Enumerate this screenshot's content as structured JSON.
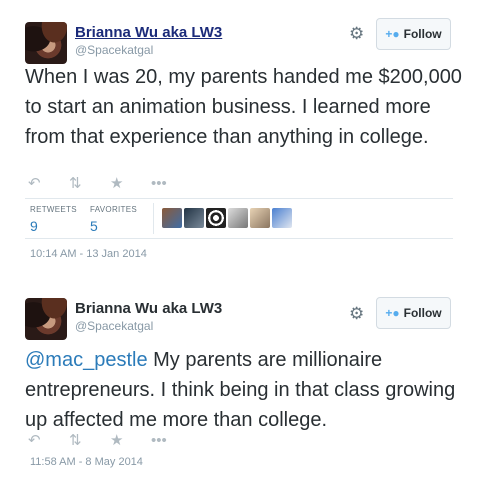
{
  "tweets": [
    {
      "name": "Brianna Wu aka LW3",
      "handle": "@Spacekatgal",
      "follow_label": "Follow",
      "text": "When I was 20, my parents handed me $200,000 to start an animation business. I learned more from that experience than anything in college.",
      "retweets_label": "RETWEETS",
      "retweets": "9",
      "favorites_label": "FAVORITES",
      "favorites": "5",
      "timestamp": "10:14 AM - 13 Jan 2014"
    },
    {
      "name": "Brianna Wu aka LW3",
      "handle": "@Spacekatgal",
      "follow_label": "Follow",
      "mention": "@mac_pestle",
      "text": " My parents are millionaire entrepreneurs. I think being in that class growing up affected me more than college.",
      "timestamp": "11:58 AM - 8 May 2014"
    }
  ],
  "icons": {
    "reply": "reply-icon",
    "retweet": "retweet-icon",
    "favorite": "star-icon",
    "more": "more-icon",
    "settings": "gear-icon",
    "follow": "add-person-icon"
  },
  "colors": {
    "link": "#2b7bb9",
    "accent": "#55acee",
    "muted": "#8899a6"
  }
}
